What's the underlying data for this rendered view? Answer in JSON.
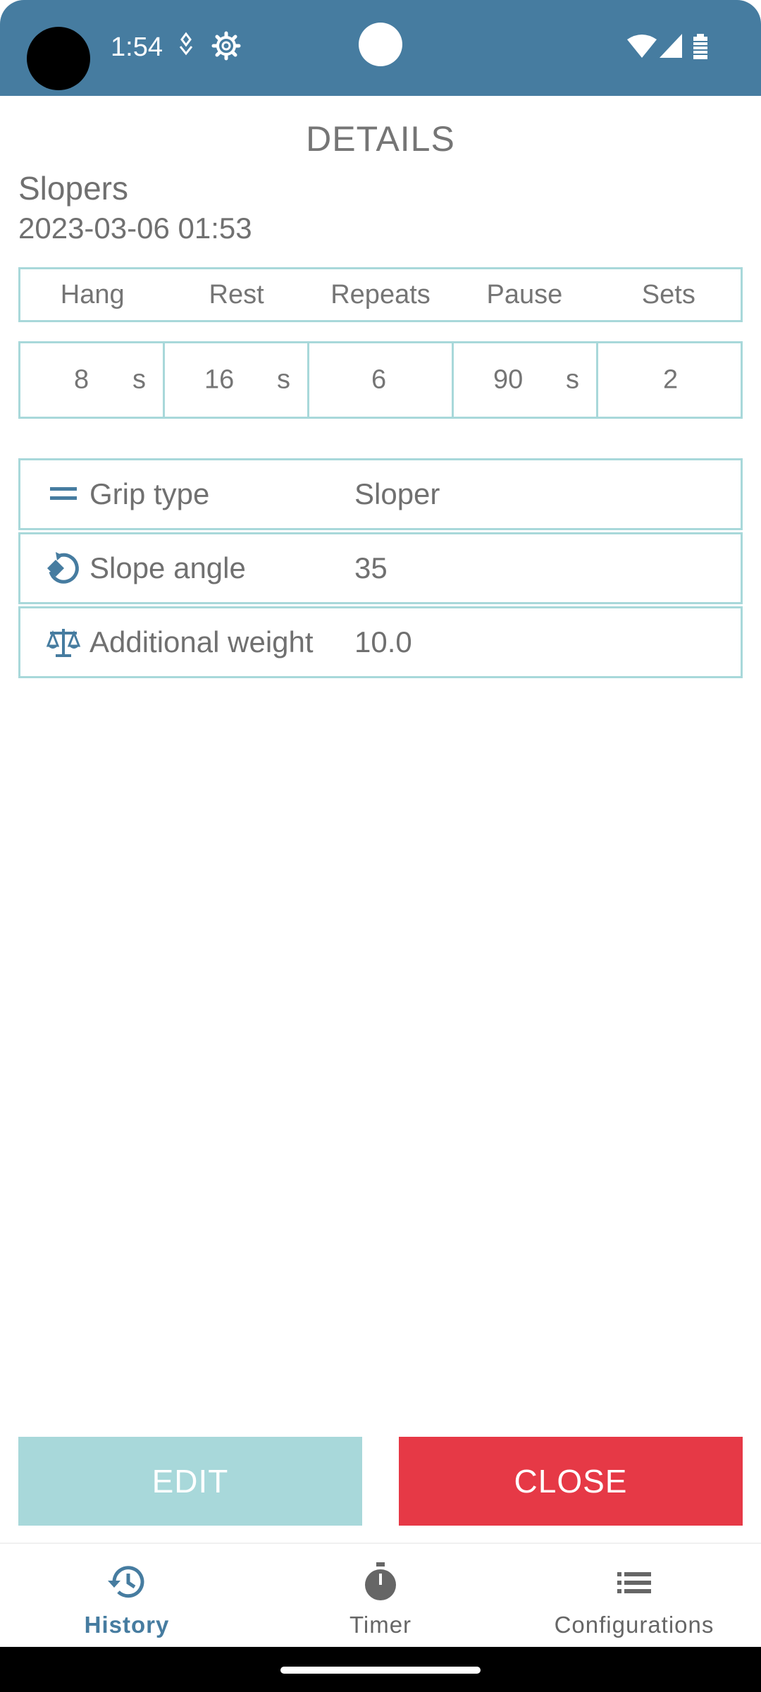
{
  "status_bar": {
    "time": "1:54",
    "icons": [
      "notification-icon",
      "settings-gear-icon",
      "wifi-icon",
      "cell-signal-icon",
      "battery-icon"
    ],
    "color": "#467ca0"
  },
  "page": {
    "title": "DETAILS",
    "exercise_name": "Slopers",
    "date": "2023-03-06 01:53"
  },
  "params": {
    "headers": [
      "Hang",
      "Rest",
      "Repeats",
      "Pause",
      "Sets"
    ],
    "hang": {
      "value": "8",
      "unit": "s"
    },
    "rest": {
      "value": "16",
      "unit": "s"
    },
    "repeats": {
      "value": "6"
    },
    "pause": {
      "value": "90",
      "unit": "s"
    },
    "sets": {
      "value": "2"
    }
  },
  "details": [
    {
      "icon": "grip-lines-icon",
      "label": "Grip type",
      "value": "Sloper"
    },
    {
      "icon": "rotate-angle-icon",
      "label": "Slope angle",
      "value": "35"
    },
    {
      "icon": "scale-balance-icon",
      "label": "Additional weight",
      "value": "10.0"
    }
  ],
  "buttons": {
    "edit": "EDIT",
    "close": "CLOSE",
    "edit_color": "#a8d8da",
    "close_color": "#e63946"
  },
  "nav": {
    "items": [
      {
        "label": "History",
        "icon": "history-icon",
        "active": true
      },
      {
        "label": "Timer",
        "icon": "stopwatch-icon",
        "active": false
      },
      {
        "label": "Configurations",
        "icon": "list-icon",
        "active": false
      }
    ],
    "accent": "#467ca0"
  }
}
